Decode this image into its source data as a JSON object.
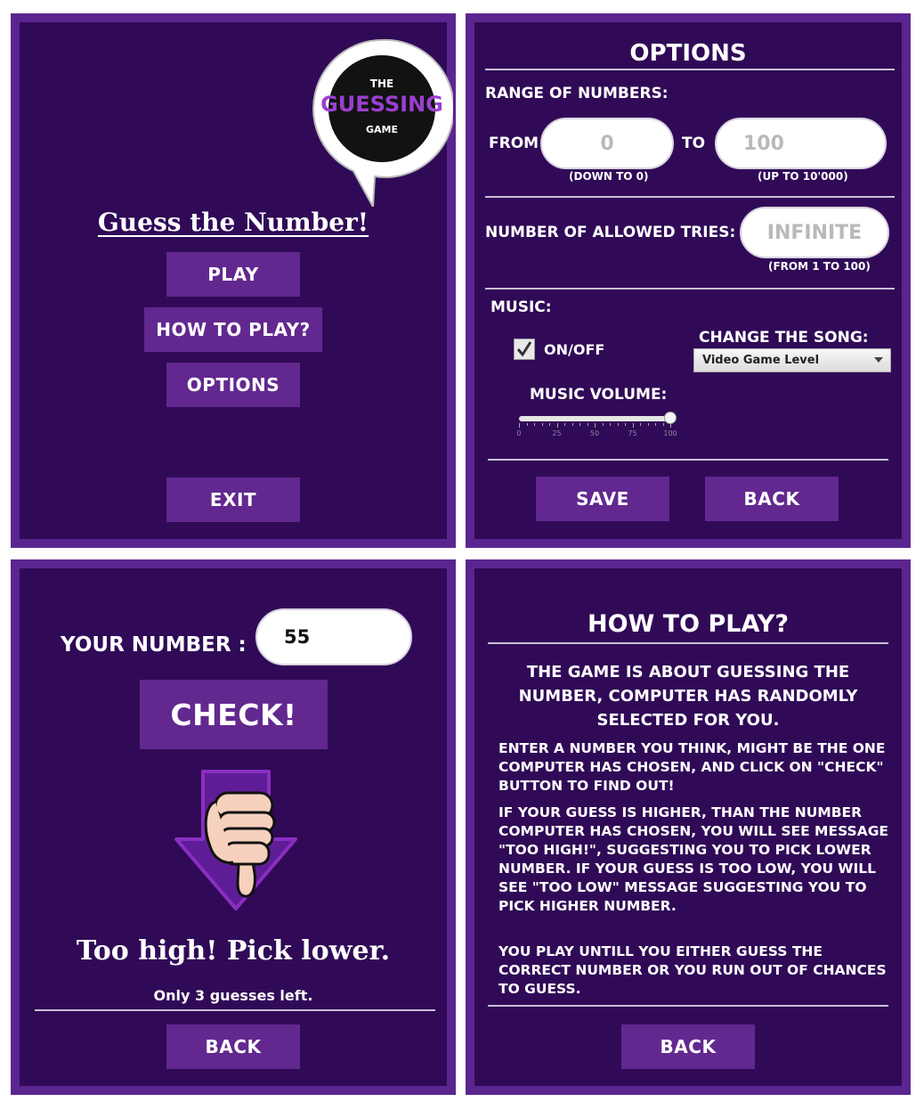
{
  "menu": {
    "logo": {
      "line1": "THE",
      "line2": "GUESSING",
      "line3": "GAME"
    },
    "title": "Guess the Number!",
    "play": "PLAY",
    "how_to_play": "HOW TO PLAY?",
    "options": "OPTIONS",
    "exit": "EXIT"
  },
  "options": {
    "title": "OPTIONS",
    "range_label": "RANGE OF NUMBERS:",
    "from_label": "FROM",
    "from_placeholder": "0",
    "from_hint": "(DOWN TO 0)",
    "to_label": "TO",
    "to_placeholder": "100",
    "to_hint": "(UP TO 10'000)",
    "tries_label": "NUMBER OF ALLOWED TRIES:",
    "tries_placeholder": "INFINITE",
    "tries_hint": "(FROM 1 TO 100)",
    "music_label": "MUSIC:",
    "music_toggle_label": "ON/OFF",
    "music_on": true,
    "change_song_label": "CHANGE THE SONG:",
    "song_selected": "Video Game Level",
    "volume_label": "MUSIC VOLUME:",
    "volume_value": 100,
    "volume_ticks": [
      "0",
      "25",
      "50",
      "75",
      "100"
    ],
    "save": "SAVE",
    "back": "BACK"
  },
  "game": {
    "your_number_label": "YOUR NUMBER :",
    "number_value": "55",
    "check": "CHECK!",
    "result": "Too high! Pick lower.",
    "guesses_left": "Only 3 guesses left.",
    "back": "BACK"
  },
  "how_to_play": {
    "title": "HOW TO PLAY?",
    "intro": "THE GAME IS ABOUT GUESSING THE NUMBER, COMPUTER HAS RANDOMLY SELECTED FOR YOU.",
    "p1": "ENTER A NUMBER YOU THINK, MIGHT BE THE ONE COMPUTER HAS CHOSEN, AND CLICK ON \"CHECK\" BUTTON TO FIND OUT!",
    "p2": "IF YOUR GUESS IS HIGHER, THAN THE NUMBER COMPUTER HAS CHOSEN, YOU WILL SEE MESSAGE \"TOO HIGH!\", SUGGESTING YOU TO PICK LOWER NUMBER. IF YOUR GUESS IS TOO LOW, YOU WILL SEE \"TOO LOW\" MESSAGE SUGGESTING YOU TO PICK HIGHER NUMBER.",
    "p3": "YOU PLAY UNTILL YOU EITHER GUESS THE CORRECT NUMBER OR YOU RUN OUT OF CHANCES TO GUESS.",
    "back": "BACK"
  },
  "colors": {
    "panel_bg": "#300a57",
    "panel_border": "#5b2590",
    "button_bg": "#62288f",
    "accent_purple": "#8a2ec2"
  }
}
